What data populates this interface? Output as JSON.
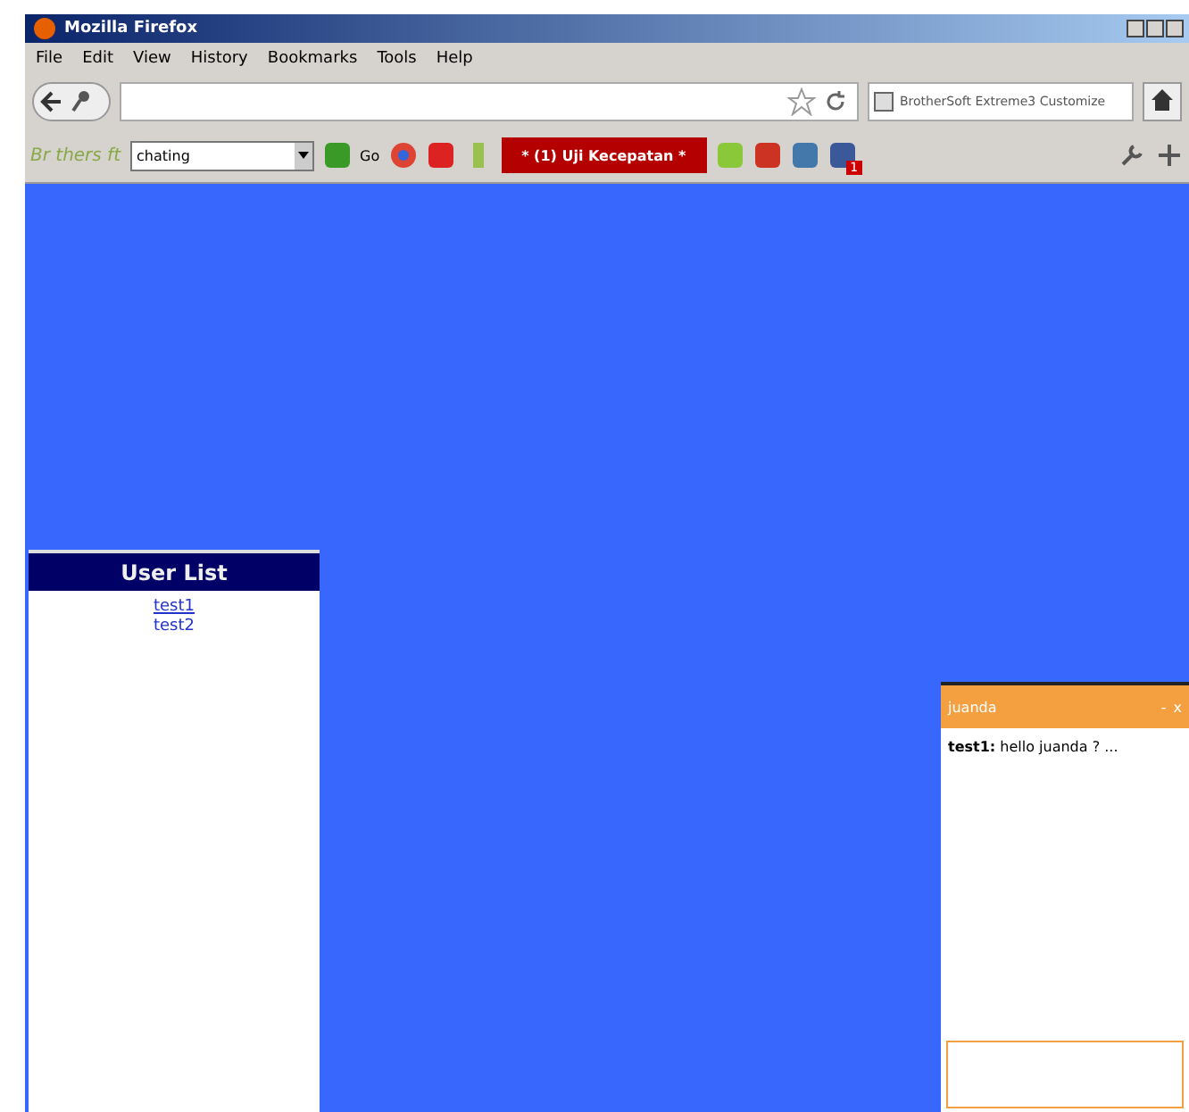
{
  "window": {
    "title": "Mozilla Firefox"
  },
  "menu": [
    "File",
    "Edit",
    "View",
    "History",
    "Bookmarks",
    "Tools",
    "Help"
  ],
  "search": {
    "placeholder": "BrotherSoft Extreme3 Customize"
  },
  "toolbar": {
    "brand": "Br thers ft",
    "query": "chating",
    "go": "Go",
    "tab_button": "* (1) Uji Kecepatan *",
    "facebook_badge": "1"
  },
  "user_list": {
    "title": "User List",
    "users": [
      {
        "name": "test1",
        "selected": true
      },
      {
        "name": "test2",
        "selected": false
      }
    ]
  },
  "chat": {
    "title": "juanda",
    "minimize": "-",
    "close": "x",
    "messages": [
      {
        "sender": "test1:",
        "text": "hello juanda ? ..."
      }
    ]
  }
}
